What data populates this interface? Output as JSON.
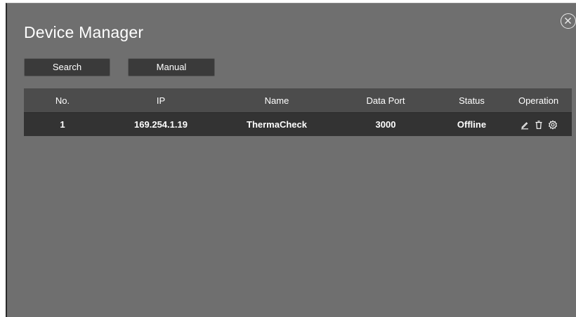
{
  "dialog": {
    "title": "Device Manager",
    "close_icon": "close-circle-icon"
  },
  "toolbar": {
    "search_label": "Search",
    "manual_label": "Manual"
  },
  "table": {
    "headers": [
      "No.",
      "IP",
      "Name",
      "Data Port",
      "Status",
      "Operation"
    ],
    "rows": [
      {
        "no": "1",
        "ip": "169.254.1.19",
        "name": "ThermaCheck",
        "data_port": "3000",
        "status": "Offline",
        "operations": [
          "edit-icon",
          "delete-icon",
          "settings-icon"
        ]
      }
    ]
  },
  "colors": {
    "panel_bg": "#6f6f6f",
    "header_bg": "#4c4c4c",
    "row_bg": "#333333",
    "button_bg": "#3a3a3a",
    "text": "#ffffff"
  }
}
